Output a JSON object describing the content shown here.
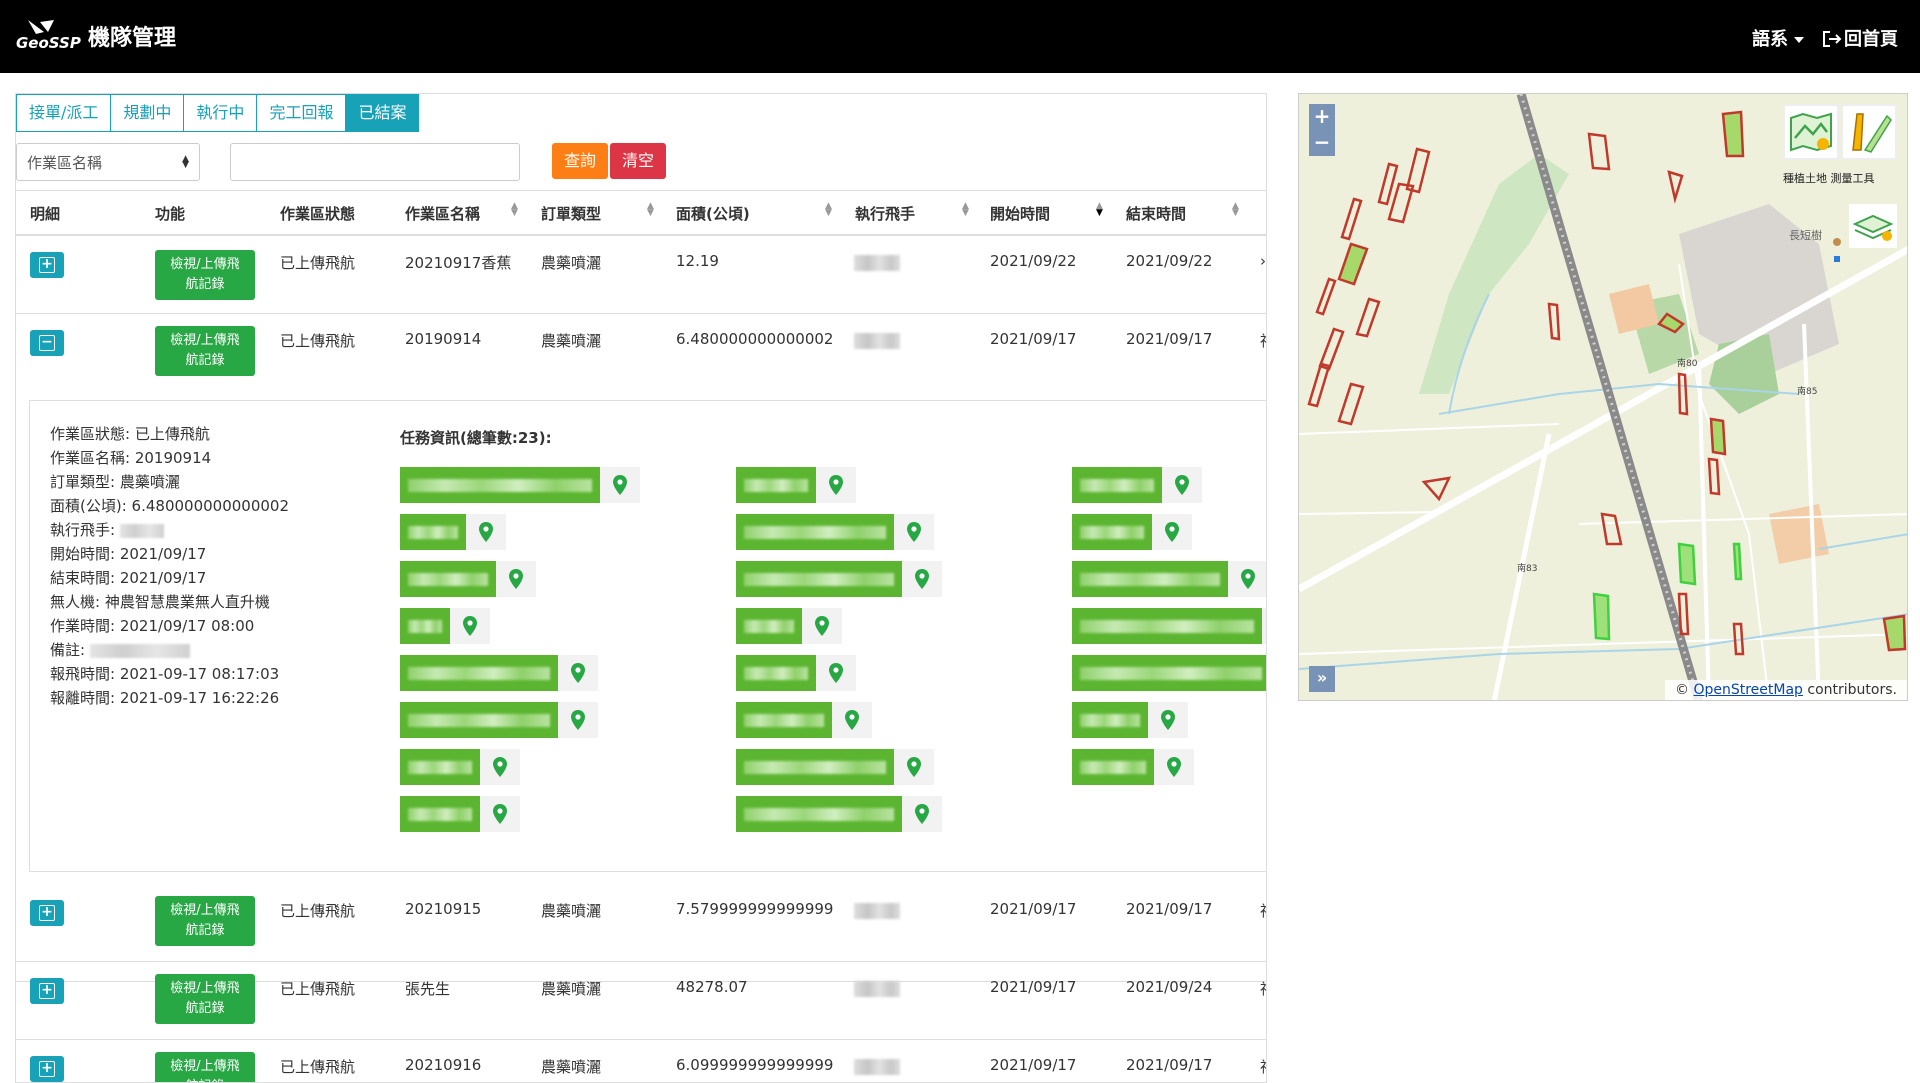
{
  "header": {
    "logo_text": "GeoSSP",
    "app_title": "機隊管理",
    "language_label": "語系",
    "home_label": "回首頁"
  },
  "tabs": [
    {
      "label": "接單/派工",
      "active": false
    },
    {
      "label": "規劃中",
      "active": false
    },
    {
      "label": "執行中",
      "active": false
    },
    {
      "label": "完工回報",
      "active": false
    },
    {
      "label": "已結案",
      "active": true
    }
  ],
  "filter": {
    "select_value": "作業區名稱",
    "input_value": "",
    "query_label": "查詢",
    "clear_label": "清空"
  },
  "table": {
    "columns": [
      "明細",
      "功能",
      "作業區狀態",
      "作業區名稱",
      "訂單類型",
      "面積(公頃)",
      "執行飛手",
      "開始時間",
      "結束時間"
    ],
    "view_button_label": "檢視/上傳飛\n航記錄",
    "rows": [
      {
        "status": "已上傳飛航",
        "name": "20210917香蕉",
        "type": "農藥噴灑",
        "area": "12.19",
        "start": "2021/09/22",
        "end": "2021/09/22",
        "trailing": "›",
        "expanded": false
      },
      {
        "status": "已上傳飛航",
        "name": "20190914",
        "type": "農藥噴灑",
        "area": "6.480000000000002",
        "start": "2021/09/17",
        "end": "2021/09/17",
        "trailing": "神",
        "expanded": true
      },
      {
        "status": "已上傳飛航",
        "name": "20210915",
        "type": "農藥噴灑",
        "area": "7.579999999999999",
        "start": "2021/09/17",
        "end": "2021/09/17",
        "trailing": "神",
        "expanded": false
      },
      {
        "status": "已上傳飛航",
        "name": "張先生",
        "type": "農藥噴灑",
        "area": "48278.07",
        "start": "2021/09/17",
        "end": "2021/09/24",
        "trailing": "神",
        "expanded": false
      },
      {
        "status": "已上傳飛航",
        "name": "20210916",
        "type": "農藥噴灑",
        "area": "6.099999999999999",
        "start": "2021/09/17",
        "end": "2021/09/17",
        "trailing": "神",
        "expanded": false
      }
    ]
  },
  "detail": {
    "lines": [
      {
        "label": "作業區狀態:",
        "value": "已上傳飛航"
      },
      {
        "label": "作業區名稱:",
        "value": "20190914"
      },
      {
        "label": "訂單類型:",
        "value": "農藥噴灑"
      },
      {
        "label": "面積(公頃):",
        "value": "6.480000000000002"
      },
      {
        "label": "執行飛手:",
        "value": ""
      },
      {
        "label": "開始時間:",
        "value": "2021/09/17"
      },
      {
        "label": "結束時間:",
        "value": "2021/09/17"
      },
      {
        "label": "無人機:",
        "value": "神農智慧農業無人直升機"
      },
      {
        "label": "作業時間:",
        "value": "2021/09/17 08:00"
      },
      {
        "label": "備註:",
        "value": ""
      },
      {
        "label": "報飛時間:",
        "value": "2021-09-17 08:17:03"
      },
      {
        "label": "報離時間:",
        "value": "2021-09-17 16:22:26"
      }
    ],
    "task_title": "任務資訊(總筆數:23):"
  },
  "map": {
    "zoom_in": "+",
    "zoom_out": "−",
    "expand": "»",
    "tool_labels": "種植土地 測量工具",
    "attribution_prefix": "© ",
    "attribution_link": "OpenStreetMap",
    "attribution_suffix": " contributors.",
    "place_labels": [
      "長短樹",
      "南80",
      "南85",
      "南83"
    ],
    "colors": {
      "field_outline": "#c0392b",
      "field_fill": "#a6d96a",
      "road": "#ffffff",
      "rail": "#8a8a8a"
    }
  },
  "colors": {
    "accent": "#17a2b8",
    "query": "#fd7e14",
    "clear": "#dc3545",
    "success": "#28a745",
    "task_bar": "#5cb531",
    "pin": "#28a745"
  }
}
